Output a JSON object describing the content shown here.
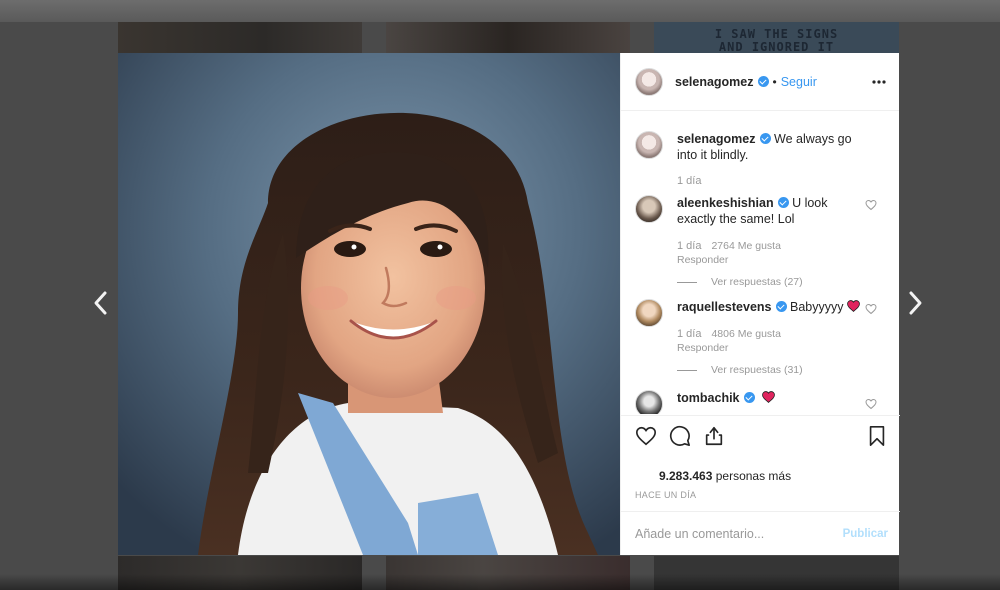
{
  "backdrop": {
    "sign_text": "I SAW THE SIGNS\nAND IGNORED IT"
  },
  "nav": {
    "prev_icon": "chevron-left-icon",
    "next_icon": "chevron-right-icon"
  },
  "post": {
    "author": "selenagomez",
    "separator": "•",
    "follow_label": "Seguir",
    "more_icon": "more-dots-icon",
    "likes_count": "9.283.463",
    "likes_suffix": "personas más",
    "timestamp": "HACE UN DÍA",
    "comment_placeholder": "Añade un comentario...",
    "publish_label": "Publicar"
  },
  "caption": {
    "username": "selenagomez",
    "text": "We always go into it blindly.",
    "age": "1 día"
  },
  "comments": [
    {
      "username": "aleenkeshishian",
      "text": "U look exactly the same! Lol",
      "age": "1 día",
      "likes": "2764 Me gusta",
      "reply_label": "Responder",
      "view_replies": "Ver respuestas (27)"
    },
    {
      "username": "raquellestevens",
      "text": "Babyyyyy",
      "age": "1 día",
      "likes": "4806 Me gusta",
      "reply_label": "Responder",
      "view_replies": "Ver respuestas (31)"
    },
    {
      "username": "tombachik",
      "text": ""
    }
  ],
  "colors": {
    "link_blue": "#3897f0",
    "muted_gray": "#999999",
    "heart_red": "#ed4956",
    "publish_disabled": "#b2dffc"
  }
}
